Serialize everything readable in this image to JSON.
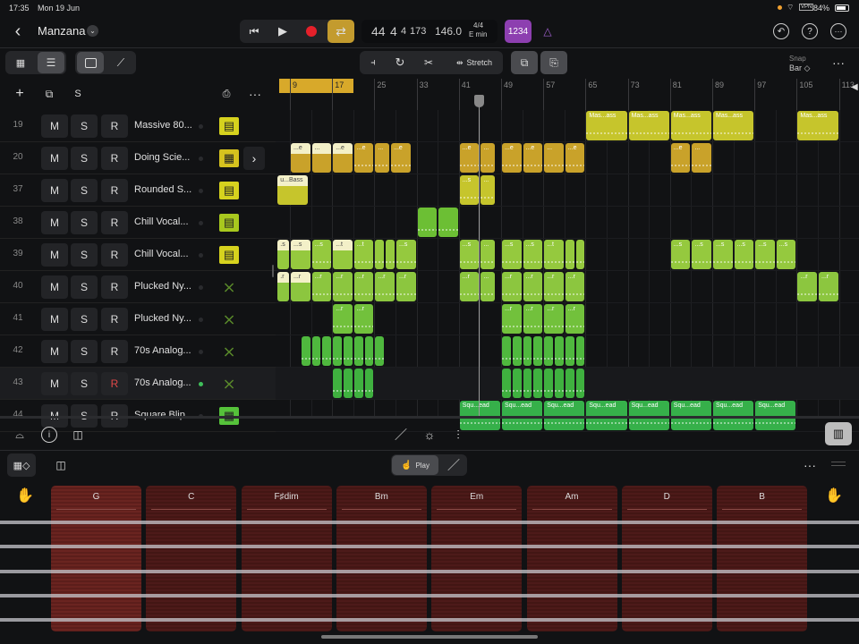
{
  "status": {
    "time": "17:35",
    "date": "Mon 19 Jun",
    "battery": "84%",
    "vpn": "VPN"
  },
  "header": {
    "project": "Manzana",
    "lcd": {
      "bar": "44",
      "beat": "4",
      "division": "4",
      "tick": "173",
      "tempo": "146.0",
      "signature": "4/4",
      "key": "E min"
    },
    "count_in": "1234"
  },
  "toolbar": {
    "stretch": "Stretch",
    "snap_label": "Snap",
    "snap_value": "Bar ◇"
  },
  "track_header": {
    "solo_label": "S"
  },
  "ruler": {
    "labels": [
      "9",
      "17",
      "25",
      "33",
      "41",
      "49",
      "57",
      "65",
      "73",
      "81",
      "89",
      "97",
      "105",
      "113"
    ],
    "cycle": [
      7,
      21
    ],
    "playhead_bar": 44.8
  },
  "colors": {
    "gold": "#c9a22a",
    "yellow": "#c6c52c",
    "lime": "#95c93e",
    "green": "#5cbf3c",
    "bright": "#36b04a",
    "chord": "#4d1a19"
  },
  "tracks": [
    {
      "num": "19",
      "name": "Massive 80...",
      "inst": "synth-yellow",
      "color": "#c6c52c",
      "regions": [
        [
          65,
          8,
          "Mas...ass"
        ],
        [
          73,
          8,
          "Mas...ass"
        ],
        [
          81,
          8,
          "Mas...ass"
        ],
        [
          89,
          8,
          "Mas...ass"
        ],
        [
          105,
          8,
          "Mas...ass"
        ]
      ]
    },
    {
      "num": "20",
      "name": "Doing Scie...",
      "inst": "drum-machine",
      "color": "#c9a22a",
      "regions": [
        [
          9,
          4,
          "...e",
          1
        ],
        [
          13,
          4,
          "...",
          1
        ],
        [
          17,
          4,
          "...e",
          1
        ],
        [
          21,
          4,
          "...e"
        ],
        [
          25,
          3,
          "..."
        ],
        [
          28,
          4,
          "...e"
        ],
        [
          41,
          4,
          "...e"
        ],
        [
          45,
          3,
          "..."
        ],
        [
          49,
          4,
          "...e"
        ],
        [
          53,
          4,
          "...e"
        ],
        [
          57,
          4,
          "..."
        ],
        [
          61,
          4,
          "...e"
        ],
        [
          81,
          4,
          "...e"
        ],
        [
          85,
          4,
          "..."
        ]
      ]
    },
    {
      "num": "37",
      "name": "Rounded S...",
      "inst": "synth-yellow",
      "color": "#c6c52c",
      "regions": [
        [
          6.5,
          6,
          "u...Bass",
          1
        ],
        [
          41,
          4,
          "...s"
        ],
        [
          45,
          3,
          "..."
        ]
      ]
    },
    {
      "num": "38",
      "name": "Chill Vocal...",
      "inst": "synth-lime",
      "color": "#6cbf34",
      "regions": [
        [
          33,
          4,
          ""
        ],
        [
          37,
          4,
          ""
        ]
      ]
    },
    {
      "num": "39",
      "name": "Chill Vocal...",
      "inst": "synth-yellow",
      "color": "#95c93e",
      "regions": [
        [
          6.5,
          2.5,
          ".s",
          1
        ],
        [
          9,
          4,
          "...s",
          1
        ],
        [
          13,
          4,
          "...s"
        ],
        [
          17,
          4,
          "...t",
          1
        ],
        [
          21,
          4,
          "...t"
        ],
        [
          25,
          2,
          ""
        ],
        [
          27,
          2,
          ""
        ],
        [
          29,
          4,
          "...s"
        ],
        [
          41,
          4,
          "...s"
        ],
        [
          45,
          3,
          "..."
        ],
        [
          49,
          4,
          "...s"
        ],
        [
          53,
          4,
          "...s"
        ],
        [
          57,
          4,
          "...t"
        ],
        [
          61,
          2,
          ""
        ],
        [
          63,
          2,
          ""
        ],
        [
          81,
          4,
          "...s"
        ],
        [
          85,
          4,
          "...s"
        ],
        [
          89,
          4,
          "...s"
        ],
        [
          93,
          4,
          "...s"
        ],
        [
          97,
          4,
          "...s"
        ],
        [
          101,
          4,
          "...s"
        ]
      ]
    },
    {
      "num": "40",
      "name": "Plucked Ny...",
      "inst": "keyboard-stand",
      "color": "#8cc63f",
      "regions": [
        [
          6.5,
          2.5,
          ".r",
          1
        ],
        [
          9,
          4,
          "...r",
          1
        ],
        [
          13,
          4,
          "...r"
        ],
        [
          17,
          4,
          "...r"
        ],
        [
          21,
          4,
          "...r"
        ],
        [
          25,
          4,
          "...r"
        ],
        [
          29,
          4,
          "...r"
        ],
        [
          41,
          4,
          "...r"
        ],
        [
          45,
          3,
          "..."
        ],
        [
          49,
          4,
          "...r"
        ],
        [
          53,
          4,
          "...r"
        ],
        [
          57,
          4,
          "...r"
        ],
        [
          61,
          4,
          "...r"
        ],
        [
          105,
          4,
          "...r"
        ],
        [
          109,
          4,
          "...r"
        ]
      ]
    },
    {
      "num": "41",
      "name": "Plucked Ny...",
      "inst": "keyboard-stand",
      "color": "#72c13c",
      "regions": [
        [
          17,
          4,
          "...r"
        ],
        [
          21,
          4,
          "...r"
        ],
        [
          49,
          4,
          "...r"
        ],
        [
          53,
          4,
          "...r"
        ],
        [
          57,
          4,
          "...r"
        ],
        [
          61,
          4,
          "...r"
        ]
      ]
    },
    {
      "num": "42",
      "name": "70s Analog...",
      "inst": "keyboard-stand",
      "color": "#4fb83e",
      "regions": [
        [
          11,
          2,
          ""
        ],
        [
          13,
          2,
          ""
        ],
        [
          15,
          2,
          ""
        ],
        [
          17,
          2,
          ""
        ],
        [
          19,
          2,
          ""
        ],
        [
          21,
          2,
          ""
        ],
        [
          23,
          2,
          ""
        ],
        [
          25,
          2,
          ""
        ],
        [
          49,
          2,
          ""
        ],
        [
          51,
          2,
          ""
        ],
        [
          53,
          2,
          ""
        ],
        [
          55,
          2,
          ""
        ],
        [
          57,
          2,
          ""
        ],
        [
          59,
          2,
          ""
        ],
        [
          61,
          2,
          ""
        ],
        [
          63,
          2,
          ""
        ]
      ]
    },
    {
      "num": "43",
      "name": "70s Analog...",
      "inst": "keyboard-stand",
      "color": "#3fb13f",
      "record_armed": true,
      "active": true,
      "regions": [
        [
          17,
          2,
          ""
        ],
        [
          19,
          2,
          ""
        ],
        [
          21,
          2,
          ""
        ],
        [
          23,
          2,
          ""
        ],
        [
          49,
          2,
          ""
        ],
        [
          51,
          2,
          ""
        ],
        [
          53,
          2,
          ""
        ],
        [
          55,
          2,
          ""
        ],
        [
          57,
          2,
          ""
        ],
        [
          59,
          2,
          ""
        ],
        [
          61,
          2,
          ""
        ],
        [
          63,
          2,
          ""
        ]
      ]
    },
    {
      "num": "44",
      "name": "Square Blip...",
      "inst": "sampler-green",
      "color": "#36b04a",
      "regions": [
        [
          41,
          8,
          "Squ...ead"
        ],
        [
          49,
          8,
          "Squ...ead"
        ],
        [
          57,
          8,
          "Squ...ead"
        ],
        [
          65,
          8,
          "Squ...ead"
        ],
        [
          73,
          8,
          "Squ...ead"
        ],
        [
          81,
          8,
          "Squ...ead"
        ],
        [
          89,
          8,
          "Squ...ead"
        ],
        [
          97,
          8,
          "Squ...ead"
        ]
      ]
    }
  ],
  "track_buttons": {
    "mute": "M",
    "solo": "S",
    "record": "R"
  },
  "chord_strips": {
    "mode": "Play",
    "chords": [
      "G",
      "C",
      "F♯dim",
      "Bm",
      "Em",
      "Am",
      "D",
      "B"
    ],
    "selected": "G",
    "strings": 5
  }
}
